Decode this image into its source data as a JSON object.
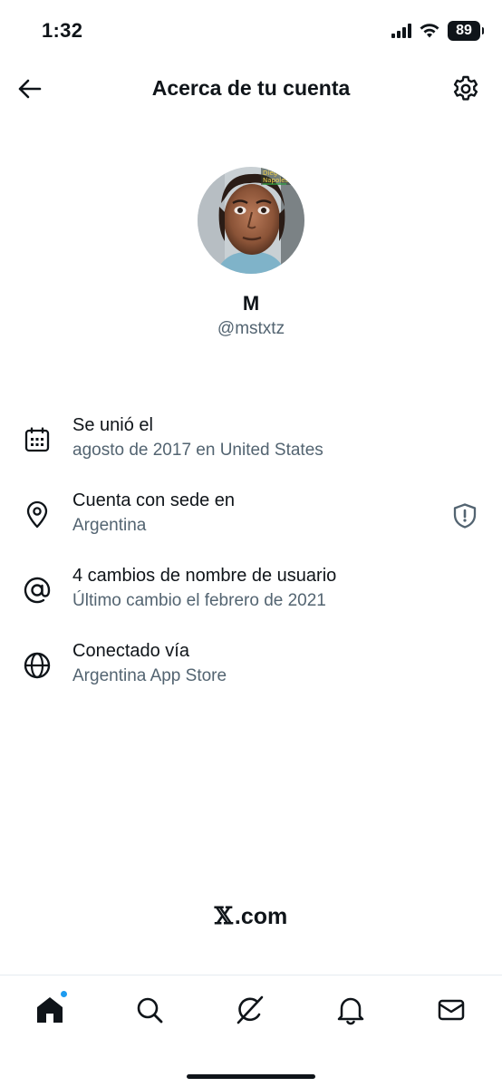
{
  "status_bar": {
    "time": "1:32",
    "battery": "89"
  },
  "header": {
    "title": "Acerca de tu cuenta"
  },
  "profile": {
    "name": "M",
    "handle": "@mstxtz",
    "avatar_overlay_text": [
      "Diego",
      "Napoles"
    ]
  },
  "info": [
    {
      "icon": "calendar-icon",
      "title": "Se unió el",
      "subtitle": "agosto de 2017 en United States"
    },
    {
      "icon": "location-pin-icon",
      "title": "Cuenta con sede en",
      "subtitle": "Argentina",
      "trailing_icon": "shield-alert-icon"
    },
    {
      "icon": "at-sign-icon",
      "title": "4 cambios de nombre de usuario",
      "subtitle": "Último cambio el febrero de 2021"
    },
    {
      "icon": "globe-icon",
      "title": "Conectado vía",
      "subtitle": "Argentina App Store"
    }
  ],
  "brand": {
    "x": "𝕏",
    "text": ".com"
  },
  "tabs": [
    {
      "name": "home",
      "icon": "home-icon",
      "has_notification_dot": true
    },
    {
      "name": "search",
      "icon": "search-icon"
    },
    {
      "name": "grok",
      "icon": "grok-icon"
    },
    {
      "name": "notifications",
      "icon": "bell-icon"
    },
    {
      "name": "messages",
      "icon": "mail-icon"
    }
  ],
  "colors": {
    "text_primary": "#0f1419",
    "text_secondary": "#536471",
    "accent": "#1d9bf0"
  }
}
